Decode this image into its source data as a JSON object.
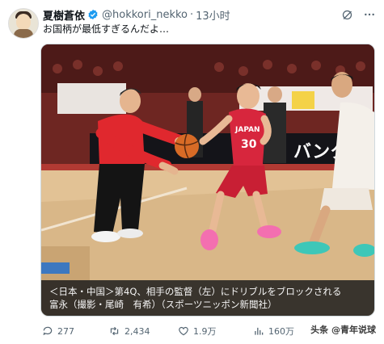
{
  "user": {
    "display_name": "夏樹蒼依",
    "handle": "@hokkori_nekko",
    "separator": "·",
    "time": "13小时"
  },
  "tweet": {
    "text": "お国柄が最低すぎるんだよ…"
  },
  "media": {
    "caption_line1": "＜日本・中国＞第4Q、相手の監督（左）にドリブルをブロックされる",
    "caption_line2": "富永（撮影・尾崎　有希）（スポーツニッポン新聞社）",
    "jersey_text": "JAPAN",
    "jersey_number": "30",
    "banner_text": "バンク"
  },
  "actions": {
    "replies": "277",
    "retweets": "2,434",
    "likes": "1.9万",
    "views": "160万"
  },
  "watermark": "头条 @青年说球",
  "colors": {
    "accent": "#1d9bf0",
    "text_secondary": "#536471",
    "japan_red": "#d7263d"
  }
}
